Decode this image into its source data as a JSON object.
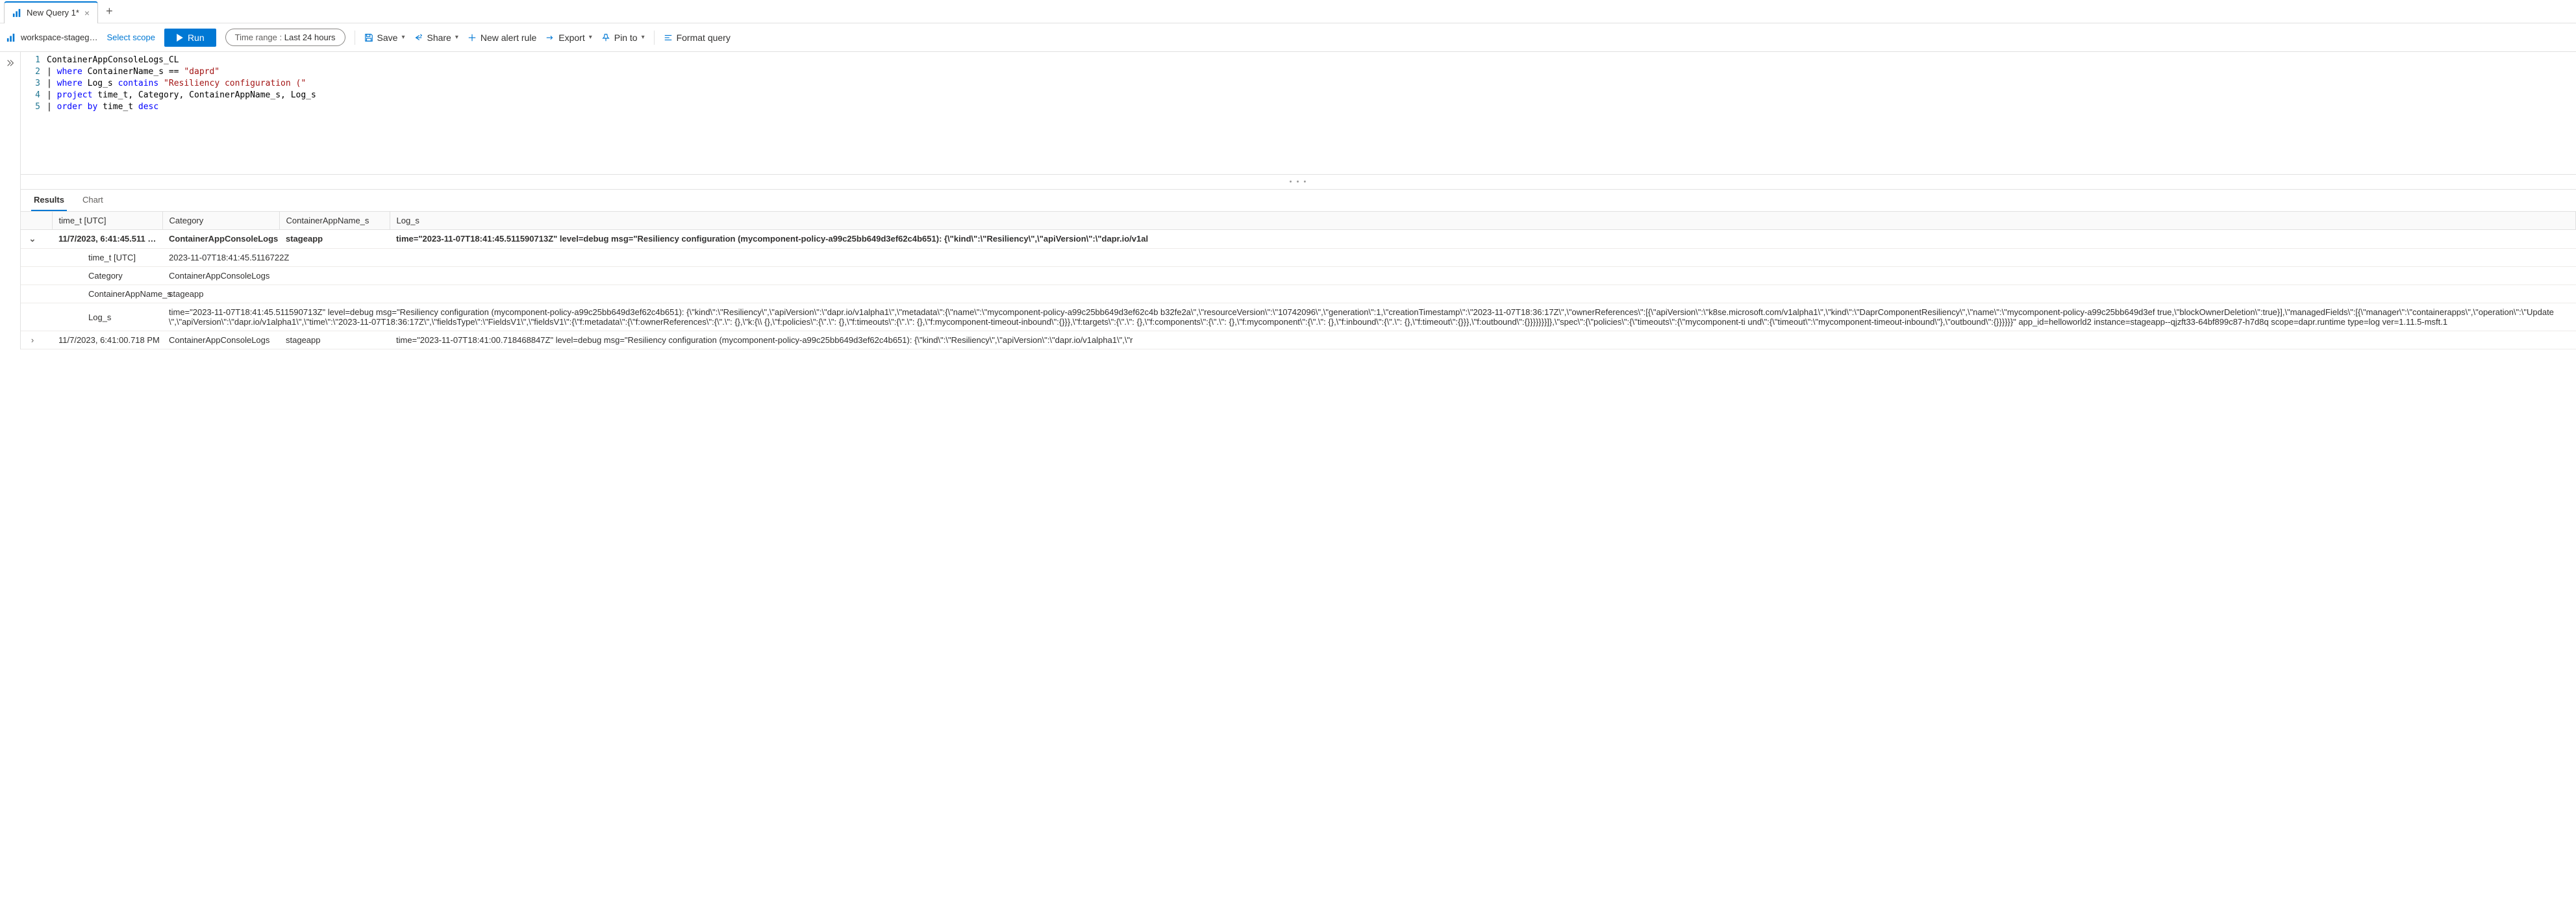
{
  "tabs": {
    "items": [
      {
        "title": "New Query 1*"
      }
    ],
    "add_icon": "+"
  },
  "toolbar": {
    "workspace": "workspace-stageg…",
    "scope_link": "Select scope",
    "run": "Run",
    "time_label": "Time range :",
    "time_value": "Last 24 hours",
    "save": "Save",
    "share": "Share",
    "new_alert": "New alert rule",
    "export": "Export",
    "pin": "Pin to",
    "format": "Format query"
  },
  "editor": {
    "lines": [
      "1",
      "2",
      "3",
      "4",
      "5"
    ],
    "l1_id": "ContainerAppConsoleLogs_CL",
    "l2_kw": "where",
    "l2_id": "ContainerName_s",
    "l2_op": "==",
    "l2_str": "\"daprd\"",
    "l3_kw": "where",
    "l3_id": "Log_s",
    "l3_func": "contains",
    "l3_str": "\"Resiliency configuration (\"",
    "l4_kw": "project",
    "l4_rest": "time_t, Category, ContainerAppName_s, Log_s",
    "l5_kw": "order by",
    "l5_id": "time_t",
    "l5_dir": "desc"
  },
  "results": {
    "tab_results": "Results",
    "tab_chart": "Chart",
    "columns": {
      "time": "time_t [UTC]",
      "category": "Category",
      "app": "ContainerAppName_s",
      "log": "Log_s"
    },
    "row1": {
      "time": "11/7/2023, 6:41:45.511 …",
      "category": "ContainerAppConsoleLogs",
      "app": "stageapp",
      "log": "time=\"2023-11-07T18:41:45.511590713Z\" level=debug msg=\"Resiliency configuration (mycomponent-policy-a99c25bb649d3ef62c4b651): {\\\"kind\\\":\\\"Resiliency\\\",\\\"apiVersion\\\":\\\"dapr.io/v1al",
      "detail_time_label": "time_t [UTC]",
      "detail_time_val": "2023-11-07T18:41:45.5116722Z",
      "detail_cat_label": "Category",
      "detail_cat_val": "ContainerAppConsoleLogs",
      "detail_app_label": "ContainerAppName_s",
      "detail_app_val": "stageapp",
      "detail_log_label": "Log_s",
      "detail_log_val": "time=\"2023-11-07T18:41:45.511590713Z\" level=debug msg=\"Resiliency configuration (mycomponent-policy-a99c25bb649d3ef62c4b651): {\\\"kind\\\":\\\"Resiliency\\\",\\\"apiVersion\\\":\\\"dapr.io/v1alpha1\\\",\\\"metadata\\\":{\\\"name\\\":\\\"mycomponent-policy-a99c25bb649d3ef62c4b b32fe2a\\\",\\\"resourceVersion\\\":\\\"10742096\\\",\\\"generation\\\":1,\\\"creationTimestamp\\\":\\\"2023-11-07T18:36:17Z\\\",\\\"ownerReferences\\\":[{\\\"apiVersion\\\":\\\"k8se.microsoft.com/v1alpha1\\\",\\\"kind\\\":\\\"DaprComponentResiliency\\\",\\\"name\\\":\\\"mycomponent-policy-a99c25bb649d3ef true,\\\"blockOwnerDeletion\\\":true}],\\\"managedFields\\\":[{\\\"manager\\\":\\\"containerapps\\\",\\\"operation\\\":\\\"Update\\\",\\\"apiVersion\\\":\\\"dapr.io/v1alpha1\\\",\\\"time\\\":\\\"2023-11-07T18:36:17Z\\\",\\\"fieldsType\\\":\\\"FieldsV1\\\",\\\"fieldsV1\\\":{\\\"f:metadata\\\":{\\\"f:ownerReferences\\\":{\\\".\\\": {},\\\"k:{\\\\ {},\\\"f:policies\\\":{\\\".\\\": {},\\\"f:timeouts\\\":{\\\".\\\": {},\\\"f:mycomponent-timeout-inbound\\\":{}}},\\\"f:targets\\\":{\\\".\\\": {},\\\"f:components\\\":{\\\".\\\": {},\\\"f:mycomponent\\\":{\\\".\\\": {},\\\"f:inbound\\\":{\\\".\\\": {},\\\"f:timeout\\\":{}}},\\\"f:outbound\\\":{}}}}}}}]},\\\"spec\\\":{\\\"policies\\\":{\\\"timeouts\\\":{\\\"mycomponent-ti und\\\":{\\\"timeout\\\":\\\"mycomponent-timeout-inbound\\\"},\\\"outbound\\\":{}}}}}}\" app_id=helloworld2 instance=stageapp--qjzft33-64bf899c87-h7d8q scope=dapr.runtime type=log ver=1.11.5-msft.1"
    },
    "row2": {
      "time": "11/7/2023, 6:41:00.718 PM",
      "category": "ContainerAppConsoleLogs",
      "app": "stageapp",
      "log": "time=\"2023-11-07T18:41:00.718468847Z\" level=debug msg=\"Resiliency configuration (mycomponent-policy-a99c25bb649d3ef62c4b651): {\\\"kind\\\":\\\"Resiliency\\\",\\\"apiVersion\\\":\\\"dapr.io/v1alpha1\\\",\\\"r"
    }
  }
}
